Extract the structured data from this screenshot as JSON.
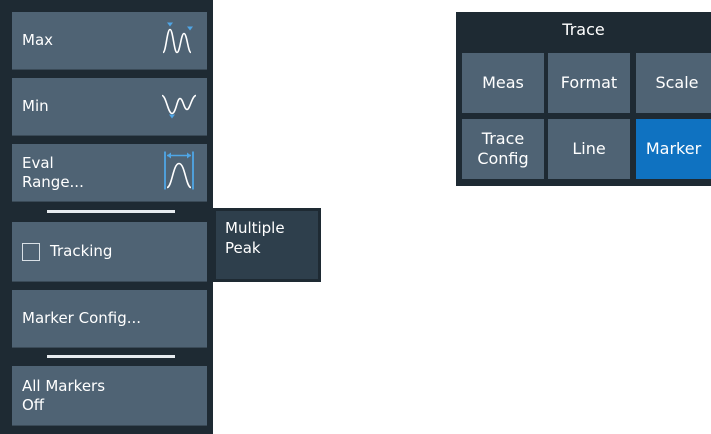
{
  "softkeys": {
    "max": "Max",
    "min": "Min",
    "eval_range": "Eval\nRange...",
    "tracking": "Tracking",
    "marker_config": "Marker Config...",
    "all_markers_off": "All Markers\nOff"
  },
  "tracking_checked": false,
  "popup": {
    "multiple_peak": "Multiple\nPeak"
  },
  "trace_panel": {
    "title": "Trace",
    "tiles": {
      "meas": "Meas",
      "format": "Format",
      "scale": "Scale",
      "trace_config": "Trace\nConfig",
      "line": "Line",
      "marker": "Marker"
    },
    "active_tile": "Marker"
  },
  "icons": {
    "max": "peak-max-icon",
    "min": "valley-min-icon",
    "eval_range": "eval-range-icon"
  },
  "colors": {
    "panel_bg": "#1e2a33",
    "key_bg": "#4f6374",
    "popup_bg": "#2e3f4c",
    "active_bg": "#0f72c1",
    "marker_icon": "#4fa6e6"
  }
}
